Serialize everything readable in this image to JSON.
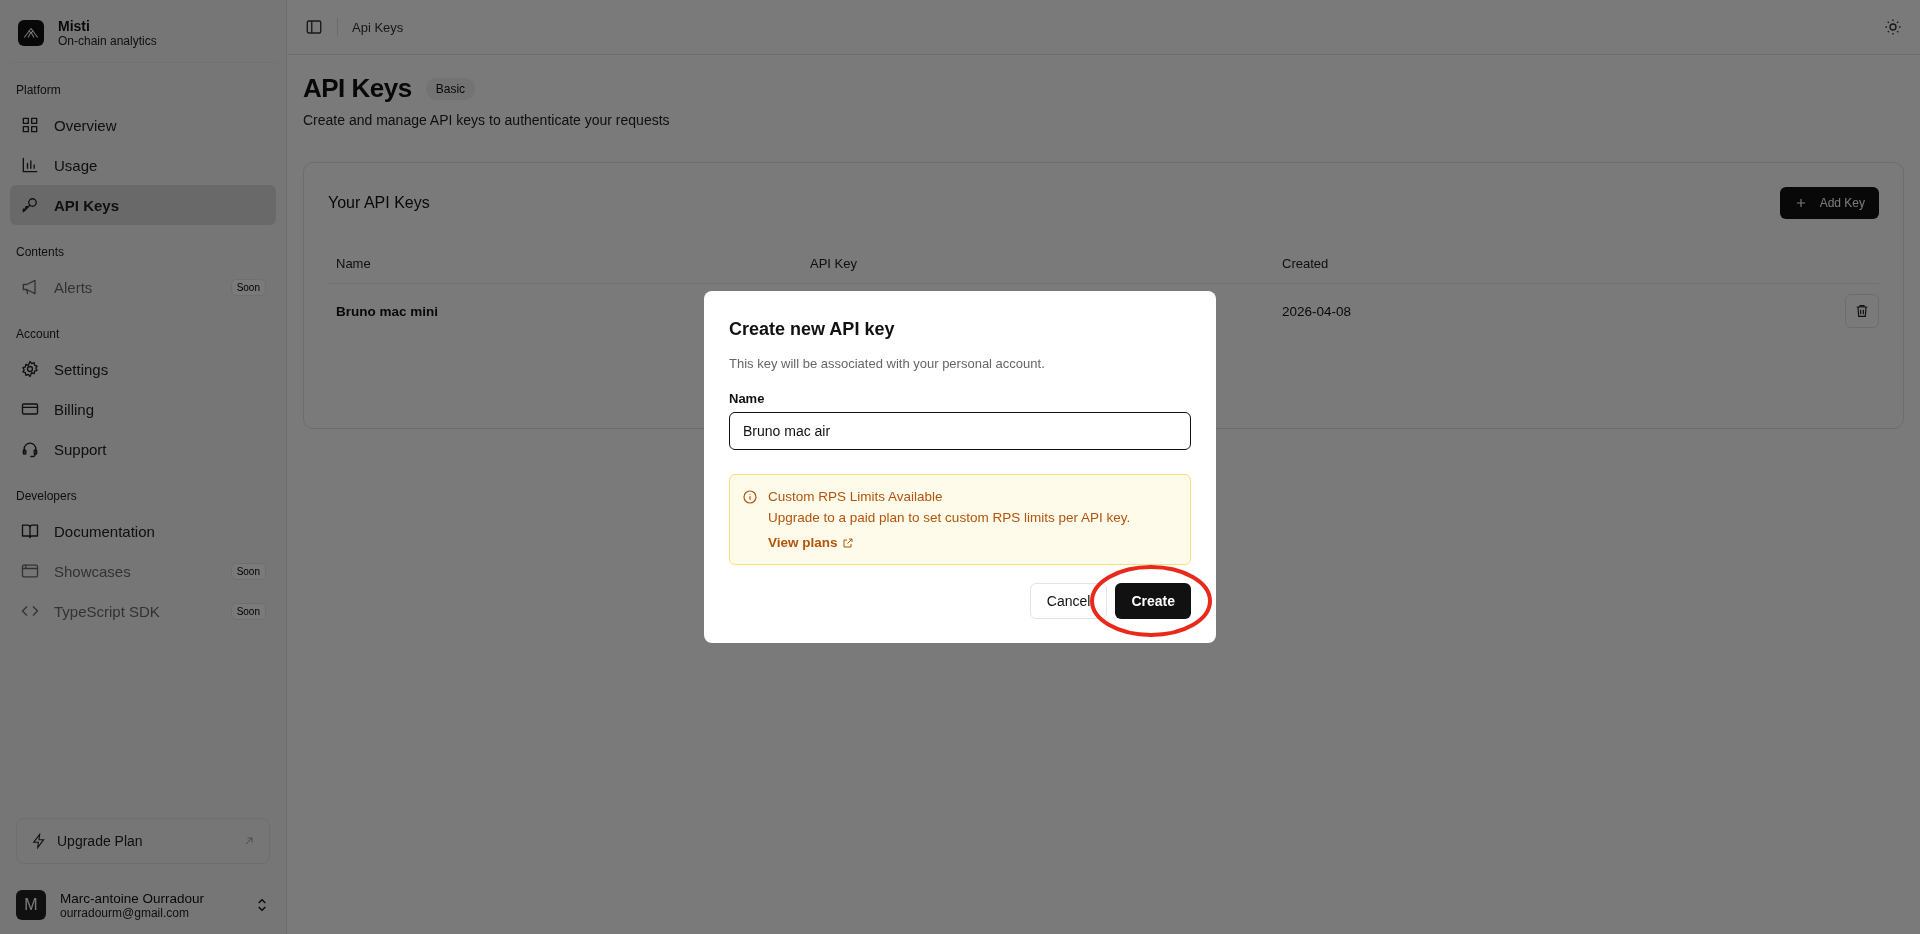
{
  "sidebar": {
    "brand": {
      "name": "Misti",
      "tagline": "On-chain analytics"
    },
    "sections": [
      {
        "title": "Platform",
        "items": [
          {
            "label": "Overview",
            "selected": false,
            "disabled": false
          },
          {
            "label": "Usage",
            "selected": false,
            "disabled": false
          },
          {
            "label": "API Keys",
            "selected": true,
            "disabled": false
          }
        ]
      },
      {
        "title": "Contents",
        "items": [
          {
            "label": "Alerts",
            "selected": false,
            "disabled": true,
            "badge": "Soon"
          }
        ]
      },
      {
        "title": "Account",
        "items": [
          {
            "label": "Settings",
            "selected": false,
            "disabled": false
          },
          {
            "label": "Billing",
            "selected": false,
            "disabled": false
          },
          {
            "label": "Support",
            "selected": false,
            "disabled": false
          }
        ]
      },
      {
        "title": "Developers",
        "items": [
          {
            "label": "Documentation",
            "selected": false,
            "disabled": false
          },
          {
            "label": "Showcases",
            "selected": false,
            "disabled": true,
            "badge": "Soon"
          },
          {
            "label": "TypeScript SDK",
            "selected": false,
            "disabled": true,
            "badge": "Soon"
          }
        ]
      }
    ],
    "upgrade": {
      "label": "Upgrade Plan"
    },
    "user": {
      "initial": "M",
      "name": "Marc-antoine Ourradour",
      "email": "ourradourm@gmail.com"
    }
  },
  "header": {
    "breadcrumb": "Api Keys"
  },
  "page": {
    "title": "API Keys",
    "plan_badge": "Basic",
    "subtitle": "Create and manage API keys to authenticate your requests"
  },
  "card": {
    "title": "Your API Keys",
    "add_button": "Add Key",
    "columns": [
      "Name",
      "API Key",
      "Created"
    ],
    "rows": [
      {
        "name": "Bruno mac mini",
        "created": "2026-04-08"
      }
    ]
  },
  "dialog": {
    "title": "Create new API key",
    "description": "This key will be associated with your personal account.",
    "field_label": "Name",
    "field_value": "Bruno mac air",
    "notice": {
      "title": "Custom RPS Limits Available",
      "text": "Upgrade to a paid plan to set custom RPS limits per API key.",
      "link": "View plans"
    },
    "buttons": [
      {
        "label": "Cancel",
        "kind": "secondary"
      },
      {
        "label": "Create",
        "kind": "primary"
      }
    ]
  },
  "annotation": {
    "kind": "ellipse",
    "color": "#e8291c"
  }
}
